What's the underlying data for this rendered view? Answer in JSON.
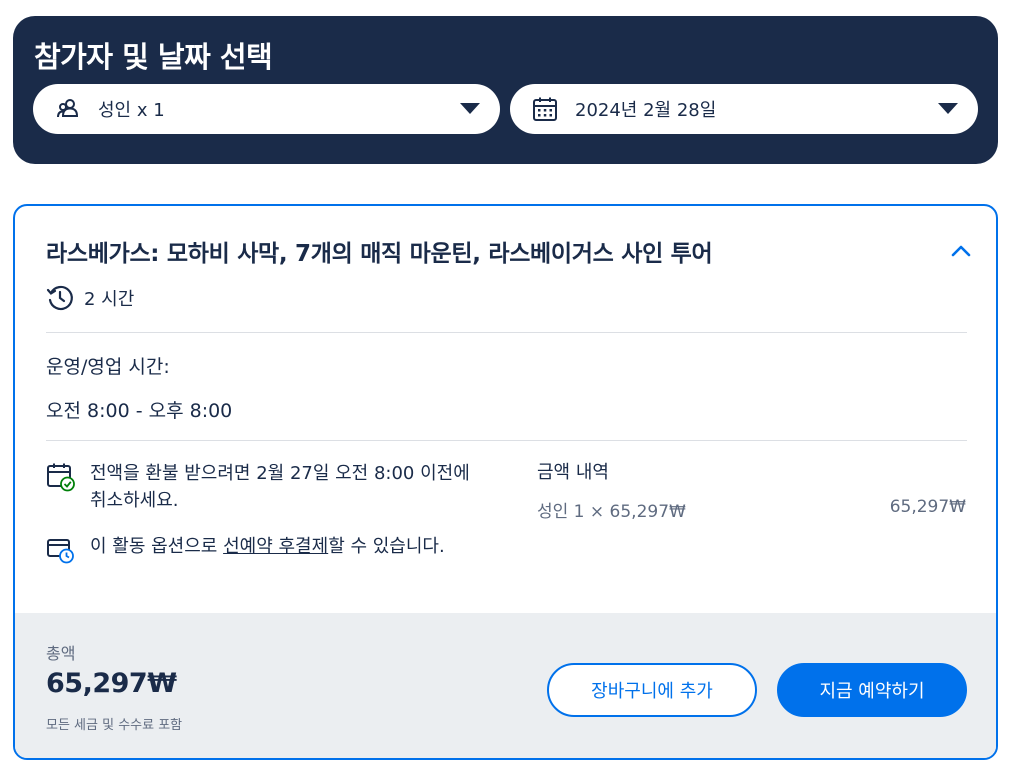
{
  "selector": {
    "title": "참가자 및 날짜 선택",
    "participants": {
      "label": "성인 x 1",
      "icon": "people-icon"
    },
    "date": {
      "label": "2024년 2월 28일",
      "icon": "calendar-icon"
    }
  },
  "option": {
    "title": "라스베가스: 모하비 사막, 7개의 매직 마운틴, 라스베이거스 사인 투어",
    "duration": "2 시간",
    "hours_label": "운영/영업 시간:",
    "hours_value": "오전 8:00 - 오후 8:00",
    "cancellation": {
      "text": "전액을 환불 받으려면 2월 27일 오전 8:00 이전에 취소하세요.",
      "icon": "calendar-check-icon"
    },
    "reserve_now": {
      "text_before": "이 활동 옵션으로 ",
      "link_text": "선예약 후결제",
      "text_after": "할 수 있습니다.",
      "icon": "wallet-clock-icon"
    },
    "price_breakdown": {
      "label": "금액 내역",
      "line_label": "성인 1 × 65,297₩",
      "line_amount": "65,297₩"
    }
  },
  "footer": {
    "total_label": "총액",
    "total_amount": "65,297₩",
    "total_note": "모든 세금 및 수수료 포함",
    "add_to_cart": "장바구니에 추가",
    "book_now": "지금 예약하기"
  },
  "colors": {
    "navy": "#1a2b49",
    "accent_blue": "#0071eb",
    "footer_bg": "#ebeef1",
    "check_green": "#008009"
  }
}
